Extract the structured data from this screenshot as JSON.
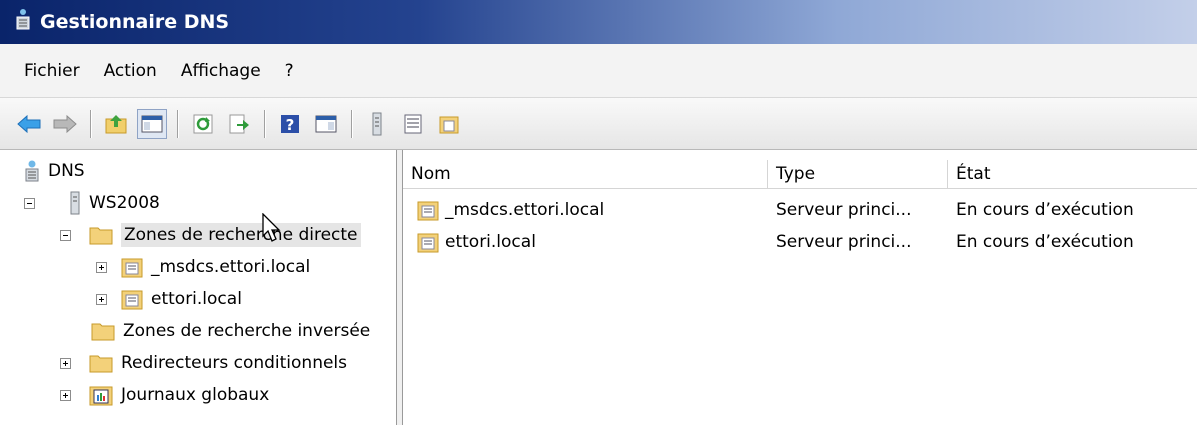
{
  "window": {
    "title": "Gestionnaire DNS"
  },
  "menu": [
    "Fichier",
    "Action",
    "Affichage",
    "?"
  ],
  "toolbar": {
    "icons": [
      "back-arrow-icon",
      "forward-arrow-icon",
      "up-folder-icon",
      "show-hide-console-tree-icon",
      "refresh-icon",
      "export-list-icon",
      "help-icon",
      "properties-icon",
      "server-icon",
      "list-view-icon",
      "zone-icon"
    ]
  },
  "tree": {
    "root": "DNS",
    "server": "WS2008",
    "forward_zones": "Zones de recherche directe",
    "zone1": "_msdcs.ettori.local",
    "zone2": "ettori.local",
    "reverse_zones": "Zones de recherche inversée",
    "conditional": "Redirecteurs conditionnels",
    "logs": "Journaux globaux"
  },
  "list": {
    "headers": {
      "name": "Nom",
      "type": "Type",
      "state": "État"
    },
    "rows": [
      {
        "name": "_msdcs.ettori.local",
        "type": "Serveur princi...",
        "state": "En cours d’exécution"
      },
      {
        "name": "ettori.local",
        "type": "Serveur princi...",
        "state": "En cours d’exécution"
      }
    ]
  },
  "colors": {
    "title_gradient_start": "#0a246a",
    "selection": "#e5e5e5",
    "folder": "#f3d17a"
  }
}
